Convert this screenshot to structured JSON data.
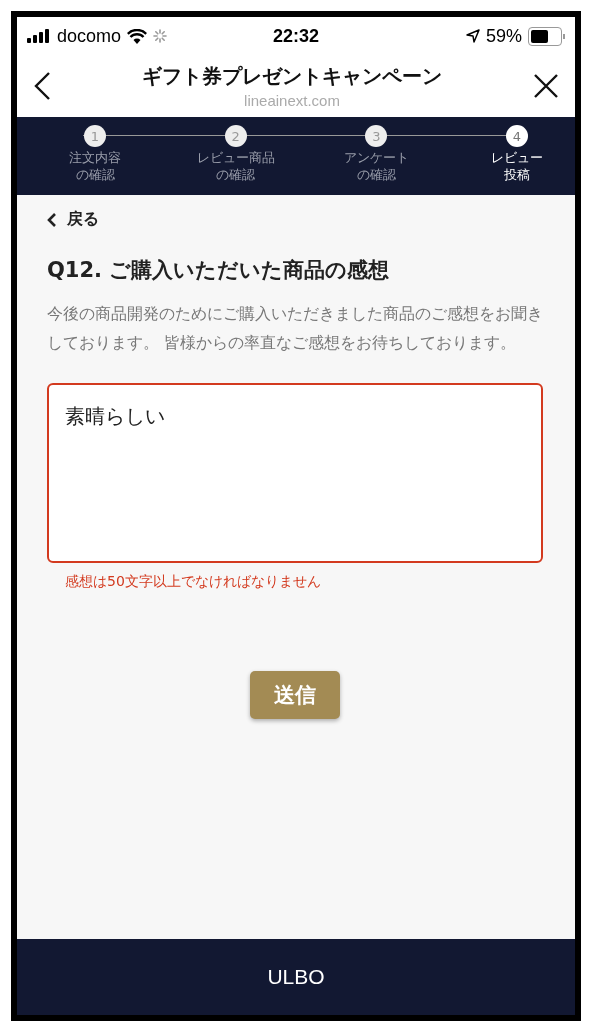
{
  "status_bar": {
    "carrier": "docomo",
    "time": "22:32",
    "battery": "59%"
  },
  "header": {
    "title": "ギフト券プレゼントキャンペーン",
    "domain": "lineainext.com"
  },
  "steps": [
    {
      "number": "1",
      "label": [
        "注文内容",
        "の確認"
      ],
      "selected": false
    },
    {
      "number": "2",
      "label": [
        "レビュー商品",
        "の確認"
      ],
      "selected": false
    },
    {
      "number": "3",
      "label": [
        "アンケート",
        "の確認"
      ],
      "selected": false
    },
    {
      "number": "4",
      "label": [
        "レビュー",
        "投稿"
      ],
      "selected": true
    }
  ],
  "back_link": "戻る",
  "question": {
    "title": "Q12. ご購入いただいた商品の感想",
    "description": "今後の商品開発のためにご購入いただきました商品のご感想をお聞きしております。 皆様からの率直なご感想をお待ちしております。",
    "answer": "素晴らしい",
    "error": "感想は50文字以上でなければなりません"
  },
  "submit_button": "送信",
  "footer": "ULBO"
}
